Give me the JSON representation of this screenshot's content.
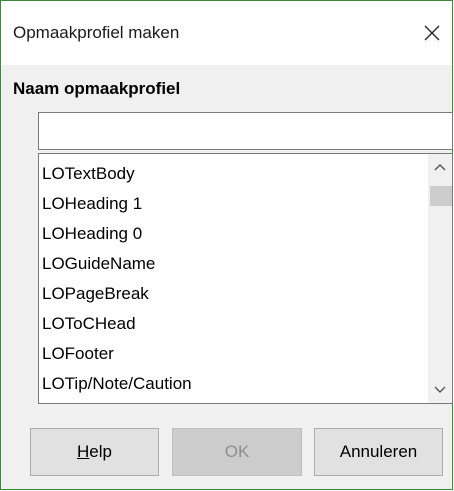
{
  "dialog": {
    "title": "Opmaakprofiel maken",
    "close_icon": "close-icon"
  },
  "name_section": {
    "label": "Naam opmaakprofiel",
    "input_value": ""
  },
  "styles_list": {
    "items": [
      "LOTextBody",
      "LOHeading 1",
      "LOHeading 0",
      "LOGuideName",
      "LOPageBreak",
      "LOToCHead",
      "LOFooter",
      "LOTip/Note/Caution"
    ]
  },
  "buttons": {
    "help_mnemonic": "H",
    "help_rest": "elp",
    "ok": "OK",
    "cancel": "Annuleren"
  }
}
